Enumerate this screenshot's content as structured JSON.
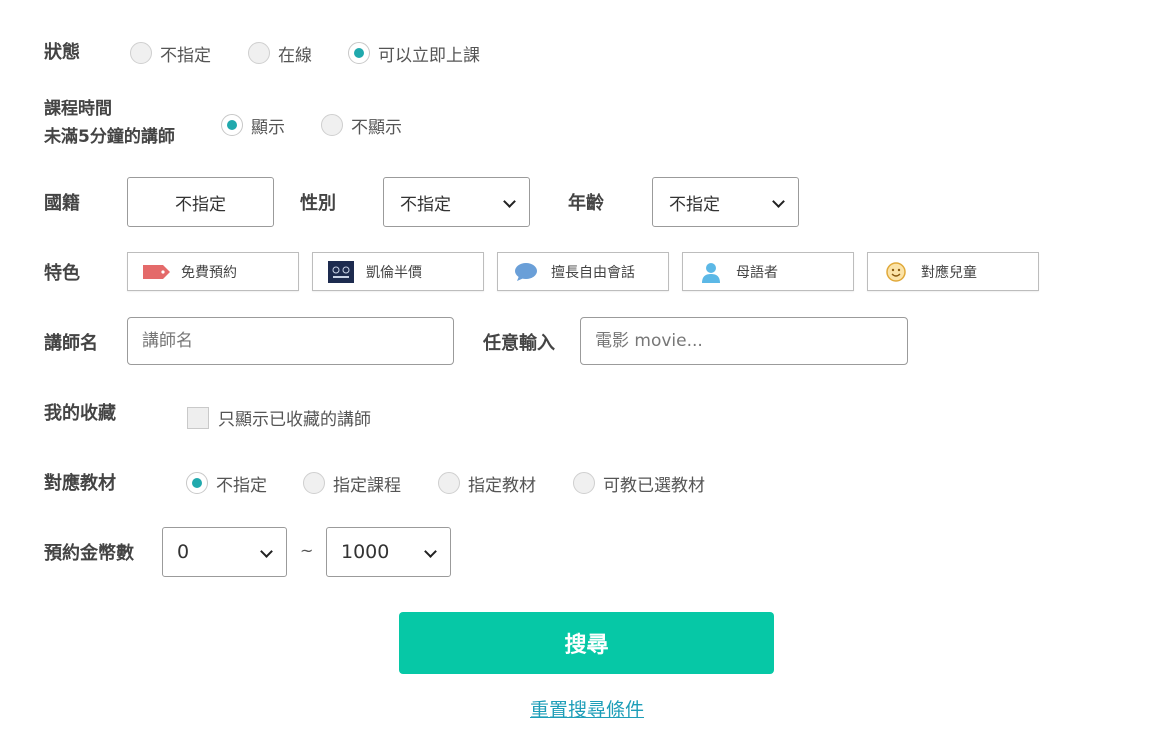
{
  "status": {
    "label": "狀態",
    "options": [
      {
        "label": "不指定",
        "selected": false
      },
      {
        "label": "在線",
        "selected": false
      },
      {
        "label": "可以立即上課",
        "selected": true
      }
    ]
  },
  "short_lesson": {
    "label_line1": "課程時間",
    "label_line2": "未滿5分鐘的講師",
    "options": [
      {
        "label": "顯示",
        "selected": true
      },
      {
        "label": "不顯示",
        "selected": false
      }
    ]
  },
  "nationality": {
    "label": "國籍",
    "value": "不指定"
  },
  "gender": {
    "label": "性別",
    "value": "不指定"
  },
  "age": {
    "label": "年齡",
    "value": "不指定"
  },
  "features": {
    "label": "特色",
    "items": [
      {
        "label": "免費預約",
        "icon": "tag-icon"
      },
      {
        "label": "凱倫半價",
        "icon": "badge-icon"
      },
      {
        "label": "擅長自由會話",
        "icon": "speech-bubble-icon"
      },
      {
        "label": "母語者",
        "icon": "person-icon"
      },
      {
        "label": "對應兒童",
        "icon": "smiley-icon"
      }
    ]
  },
  "teacher_name": {
    "label": "講師名",
    "placeholder": "講師名"
  },
  "keyword": {
    "label": "任意輸入",
    "placeholder": "電影 movie..."
  },
  "favorites": {
    "label": "我的收藏",
    "checkbox_label": "只顯示已收藏的講師",
    "checked": false
  },
  "materials": {
    "label": "對應教材",
    "options": [
      {
        "label": "不指定",
        "selected": true
      },
      {
        "label": "指定課程",
        "selected": false
      },
      {
        "label": "指定教材",
        "selected": false
      },
      {
        "label": "可教已選教材",
        "selected": false
      }
    ]
  },
  "coins": {
    "label": "預約金幣數",
    "min": "0",
    "separator": "~",
    "max": "1000"
  },
  "search_button": "搜尋",
  "reset_link": "重置搜尋條件",
  "colors": {
    "accent": "#20a9ad",
    "button": "#06c8a6",
    "link": "#1e9eb8"
  }
}
